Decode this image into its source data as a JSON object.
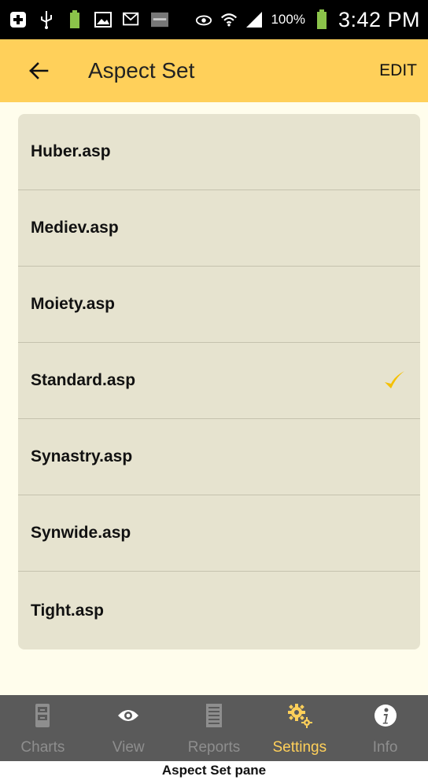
{
  "status_bar": {
    "battery_percent": "100%",
    "time": "3:42 PM",
    "icons": [
      "plus-box-icon",
      "usb-icon",
      "battery-small-icon",
      "image-icon",
      "email-icon",
      "app-icon",
      "eye-icon",
      "wifi-icon",
      "signal-icon",
      "battery-icon"
    ]
  },
  "app_bar": {
    "title": "Aspect Set",
    "edit_label": "EDIT",
    "background": "#ffd05a"
  },
  "list": {
    "items": [
      {
        "label": "Huber.asp",
        "selected": false
      },
      {
        "label": "Mediev.asp",
        "selected": false
      },
      {
        "label": "Moiety.asp",
        "selected": false
      },
      {
        "label": "Standard.asp",
        "selected": true
      },
      {
        "label": "Synastry.asp",
        "selected": false
      },
      {
        "label": "Synwide.asp",
        "selected": false
      },
      {
        "label": "Tight.asp",
        "selected": false
      }
    ],
    "check_color": "#f5c000"
  },
  "bottom_nav": {
    "items": [
      {
        "label": "Charts",
        "icon": "cabinet-icon",
        "active": false
      },
      {
        "label": "View",
        "icon": "eye-icon",
        "active": false
      },
      {
        "label": "Reports",
        "icon": "document-icon",
        "active": false
      },
      {
        "label": "Settings",
        "icon": "gears-icon",
        "active": true
      },
      {
        "label": "Info",
        "icon": "info-icon",
        "active": false
      }
    ],
    "active_color": "#ffd05a"
  },
  "caption": "Aspect Set pane"
}
